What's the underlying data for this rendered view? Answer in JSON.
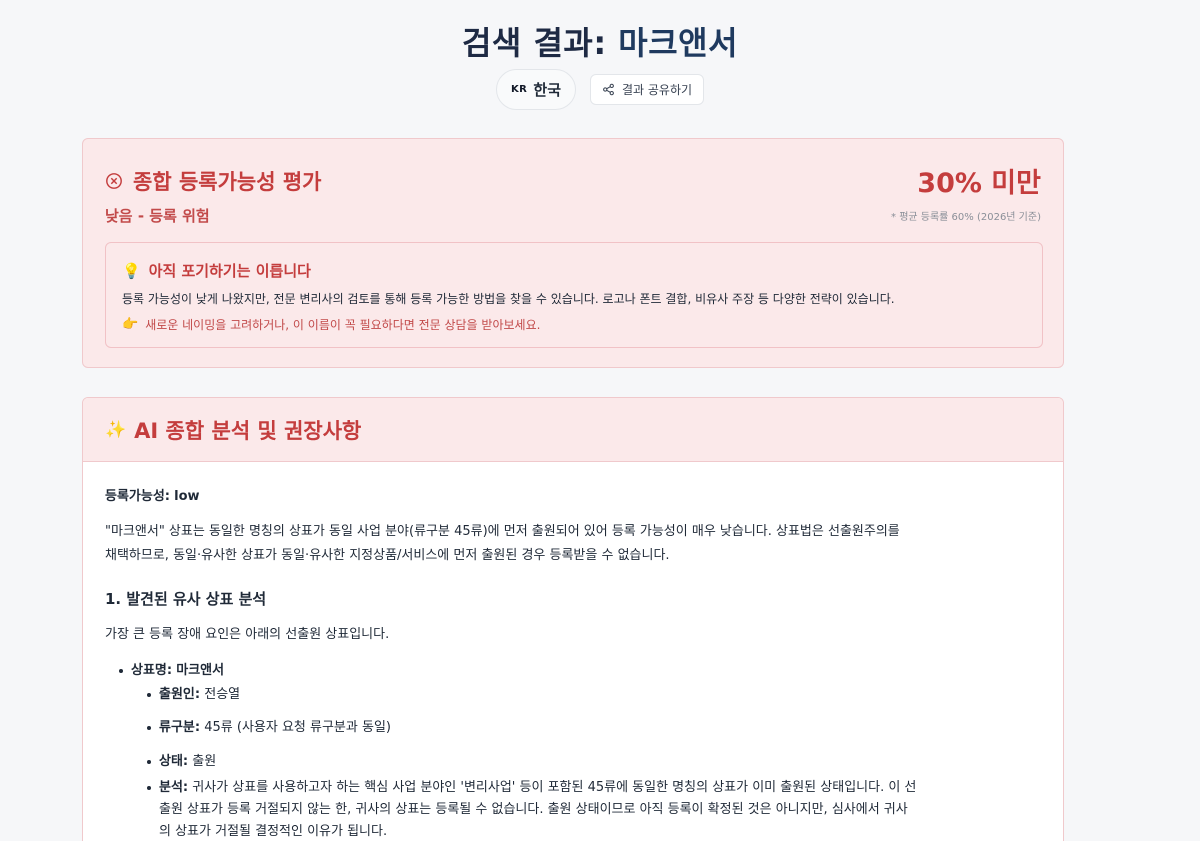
{
  "header": {
    "title_prefix": "검색 결과:",
    "title_name": "마크앤서",
    "lang_code": "KR",
    "lang_label": "한국",
    "share_label": "결과 공유하기"
  },
  "evaluation": {
    "title": "종합 등록가능성 평가",
    "score": "30% 미만",
    "level": "낮음 - 등록 위험",
    "note": "* 평균 등록률 60% (2026년 기준)",
    "tip": {
      "title": "아직 포기하기는 이릅니다",
      "body": "등록 가능성이 낮게 나왔지만, 전문 변리사의 검토를 통해 등록 가능한 방법을 찾을 수 있습니다. 로고나 폰트 결합, 비유사 주장 등 다양한 전략이 있습니다.",
      "action": "새로운 네이밍을 고려하거나, 이 이름이 꼭 필요하다면 전문 상담을 받아보세요."
    }
  },
  "ai": {
    "title": "AI 종합 분석 및 권장사항",
    "reg_label": "등록가능성:",
    "reg_value": "low",
    "intro_line1": "\"마크앤서\" 상표는 동일한 명칭의 상표가 동일 사업 분야(류구분 45류)에 먼저 출원되어 있어 등록 가능성이 매우 낮습니다. 상표법은 선출원주의를",
    "intro_line2": "채택하므로, 동일·유사한 상표가 동일·유사한 지정상품/서비스에 먼저 출원된 경우 등록받을 수 없습니다.",
    "section1_title": "1. 발견된 유사 상표 분석",
    "section1_desc": "가장 큰 등록 장애 요인은 아래의 선출원 상표입니다.",
    "mark_label": "상표명:",
    "mark_value": "마크앤서",
    "applicant_label": "출원인:",
    "applicant_value": "전승열",
    "class_label": "류구분:",
    "class_value": "45류 (사용자 요청 류구분과 동일)",
    "status_label": "상태:",
    "status_value": "출원",
    "analysis_label": "분석:",
    "analysis_line1": "귀사가 상표를 사용하고자 하는 핵심 사업 분야인 '변리사업' 등이 포함된 45류에 동일한 명칭의 상표가 이미 출원된 상태입니다. 이 선",
    "analysis_line2": "출원 상표가 등록 거절되지 않는 한, 귀사의 상표는 등록될 수 없습니다. 출원 상태이므로 아직 등록이 확정된 것은 아니지만, 심사에서 귀사",
    "analysis_line3": "의 상표가 거절될 결정적인 이유가 됩니다."
  },
  "colors": {
    "accent_red": "#c43d3d",
    "card_bg": "#fbe9ea",
    "title_navy": "#1e2a44"
  }
}
